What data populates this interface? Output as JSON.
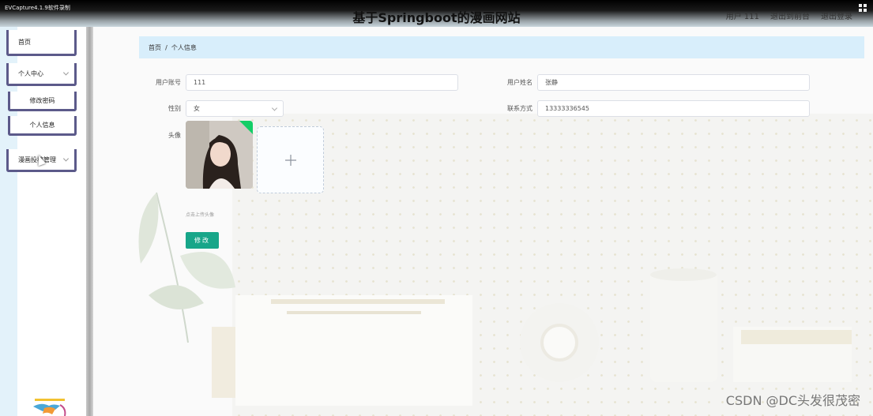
{
  "recorder": {
    "label": "EVCapture4.1.9软件录制"
  },
  "header": {
    "title": "基于Springboot的漫画网站",
    "user_label": "用户 111",
    "to_front": "退出到前台",
    "logout": "退出登录"
  },
  "sidebar": {
    "items": [
      {
        "label": "首页"
      },
      {
        "label": "个人中心"
      },
      {
        "label": "修改密码"
      },
      {
        "label": "个人信息"
      },
      {
        "label": "漫画投稿管理"
      }
    ]
  },
  "breadcrumb": {
    "home": "首页",
    "separator": "/",
    "current": "个人信息"
  },
  "form": {
    "account_label": "用户账号",
    "account_value": "111",
    "name_label": "用户姓名",
    "name_value": "张静",
    "gender_label": "性别",
    "gender_value": "女",
    "phone_label": "联系方式",
    "phone_value": "13333336545",
    "avatar_label": "头像",
    "upload_hint": "点击上传头像",
    "submit_label": "修改"
  },
  "watermark": "CSDN @DC头发很茂密",
  "colors": {
    "accent": "#17a689",
    "breadcrumb_bg": "#d8eefb",
    "sidebar_border": "#5c5a8a",
    "upload_ok": "#13ce66"
  }
}
